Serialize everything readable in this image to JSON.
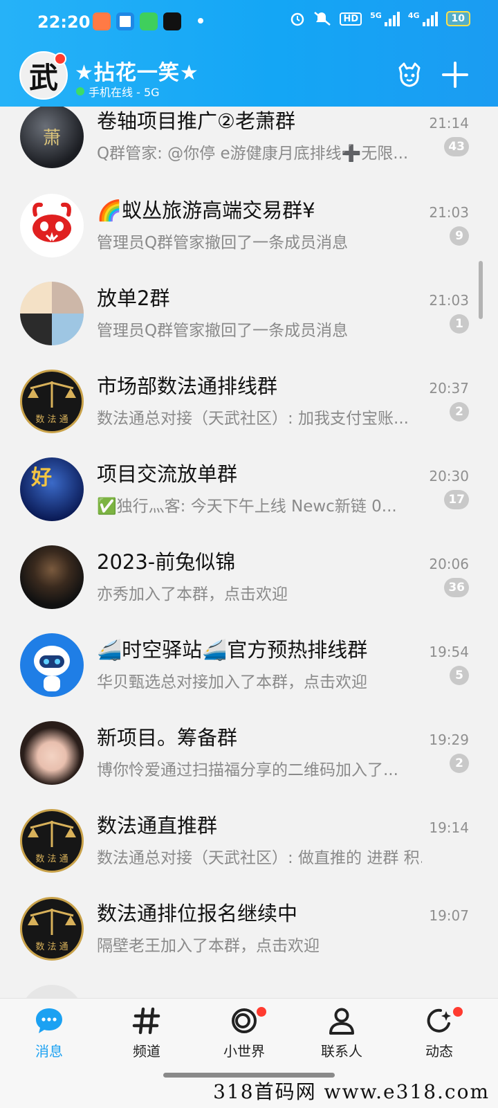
{
  "status_bar": {
    "time": "22:20",
    "network_5g": "5G",
    "network_4g": "4G",
    "hd_label": "HD",
    "battery": "10"
  },
  "header": {
    "avatar_char": "武",
    "nickname": "★拈花一笑★",
    "presence": "手机在线 - 5G"
  },
  "chats": [
    {
      "avatar_text": "萧",
      "name": "卷轴项目推广②老萧群",
      "preview": "Q群管家: @你停 e游健康月底排线➕无限...",
      "time": "21:14",
      "badge": "43"
    },
    {
      "avatar_text": "",
      "name": "🌈蚁丛旅游高端交易群¥",
      "preview": "管理员Q群管家撤回了一条成员消息",
      "time": "21:03",
      "badge": "9"
    },
    {
      "avatar_text": "",
      "name": "放单2群",
      "preview": "管理员Q群管家撤回了一条成员消息",
      "time": "21:03",
      "badge": "1"
    },
    {
      "avatar_text": "数 法 通",
      "name": "市场部数法通排线群",
      "preview": "数法通总对接（天武社区）: 加我支付宝账...",
      "time": "20:37",
      "badge": "2"
    },
    {
      "avatar_text": "好",
      "name": "项目交流放单群",
      "preview": "✅独行灬客: 今天下午上线 Newc新链 0...",
      "time": "20:30",
      "badge": "17"
    },
    {
      "avatar_text": "",
      "name": "2023-前兔似锦",
      "preview": "亦秀加入了本群，点击欢迎",
      "time": "20:06",
      "badge": "36"
    },
    {
      "avatar_text": "",
      "name": "🚄时空驿站🚄官方预热排线群",
      "preview": "华贝甄选总对接加入了本群，点击欢迎",
      "time": "19:54",
      "badge": "5"
    },
    {
      "avatar_text": "",
      "name": "新项目。筹备群",
      "preview": "博你怜爱通过扫描福分享的二维码加入了...",
      "time": "19:29",
      "badge": "2"
    },
    {
      "avatar_text": "数 法 通",
      "name": "数法通直推群",
      "preview": "数法通总对接（天武社区）: 做直推的 进群 积...",
      "time": "19:14",
      "badge": ""
    },
    {
      "avatar_text": "数 法 通",
      "name": "数法通排位报名继续中",
      "preview": "隔壁老王加入了本群，点击欢迎",
      "time": "19:07",
      "badge": ""
    }
  ],
  "bottom_nav": [
    {
      "label": "消息",
      "icon": "message-bubble-icon",
      "active": true
    },
    {
      "label": "频道",
      "icon": "hashtag-icon",
      "active": false
    },
    {
      "label": "小世界",
      "icon": "planet-icon",
      "active": false
    },
    {
      "label": "联系人",
      "icon": "person-icon",
      "active": false
    },
    {
      "label": "动态",
      "icon": "star-refresh-icon",
      "active": false
    }
  ],
  "watermark": "318首码网  www.e318.com",
  "colors": {
    "header_blue": "#14a6f5",
    "accent_blue": "#1ba1f2",
    "badge_gray": "#c9c9c9",
    "red_dot": "#ff3b30",
    "online_green": "#3ddc68"
  }
}
